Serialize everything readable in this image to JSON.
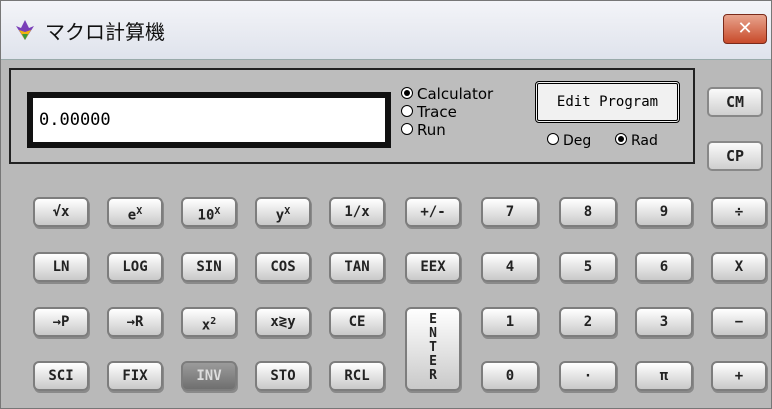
{
  "window": {
    "title": "マクロ計算機",
    "close": "✕"
  },
  "display": {
    "value": "0.00000"
  },
  "modes": [
    {
      "label": "Calculator",
      "selected": true
    },
    {
      "label": "Trace",
      "selected": false
    },
    {
      "label": "Run",
      "selected": false
    }
  ],
  "angle": [
    {
      "label": "Deg",
      "selected": false
    },
    {
      "label": "Rad",
      "selected": true
    }
  ],
  "edit_program": "Edit Program",
  "side_buttons": {
    "cm": "CM",
    "cp": "CP"
  },
  "keys": {
    "sqrt": "√x",
    "exp_base": "e",
    "exp_sup": "X",
    "ten_base": "10",
    "ten_sup": "X",
    "pow_base": "y",
    "pow_sup": "X",
    "recip": "1/x",
    "sign": "+/-",
    "n7": "7",
    "n8": "8",
    "n9": "9",
    "div": "÷",
    "ln": "LN",
    "log": "LOG",
    "sin": "SIN",
    "cos": "COS",
    "tan": "TAN",
    "eex": "EEX",
    "n4": "4",
    "n5": "5",
    "n6": "6",
    "mul": "X",
    "to_p": "→P",
    "to_r": "→R",
    "sq_base": "x",
    "sq_sup": "2",
    "swap": "x≷y",
    "ce": "CE",
    "n1": "1",
    "n2": "2",
    "n3": "3",
    "sub": "−",
    "sci": "SCI",
    "fix": "FIX",
    "inv": "INV",
    "sto": "STO",
    "rcl": "RCL",
    "n0": "0",
    "dot": "·",
    "pi": "π",
    "add": "+",
    "enter_letters": [
      "E",
      "N",
      "T",
      "E",
      "R"
    ]
  }
}
